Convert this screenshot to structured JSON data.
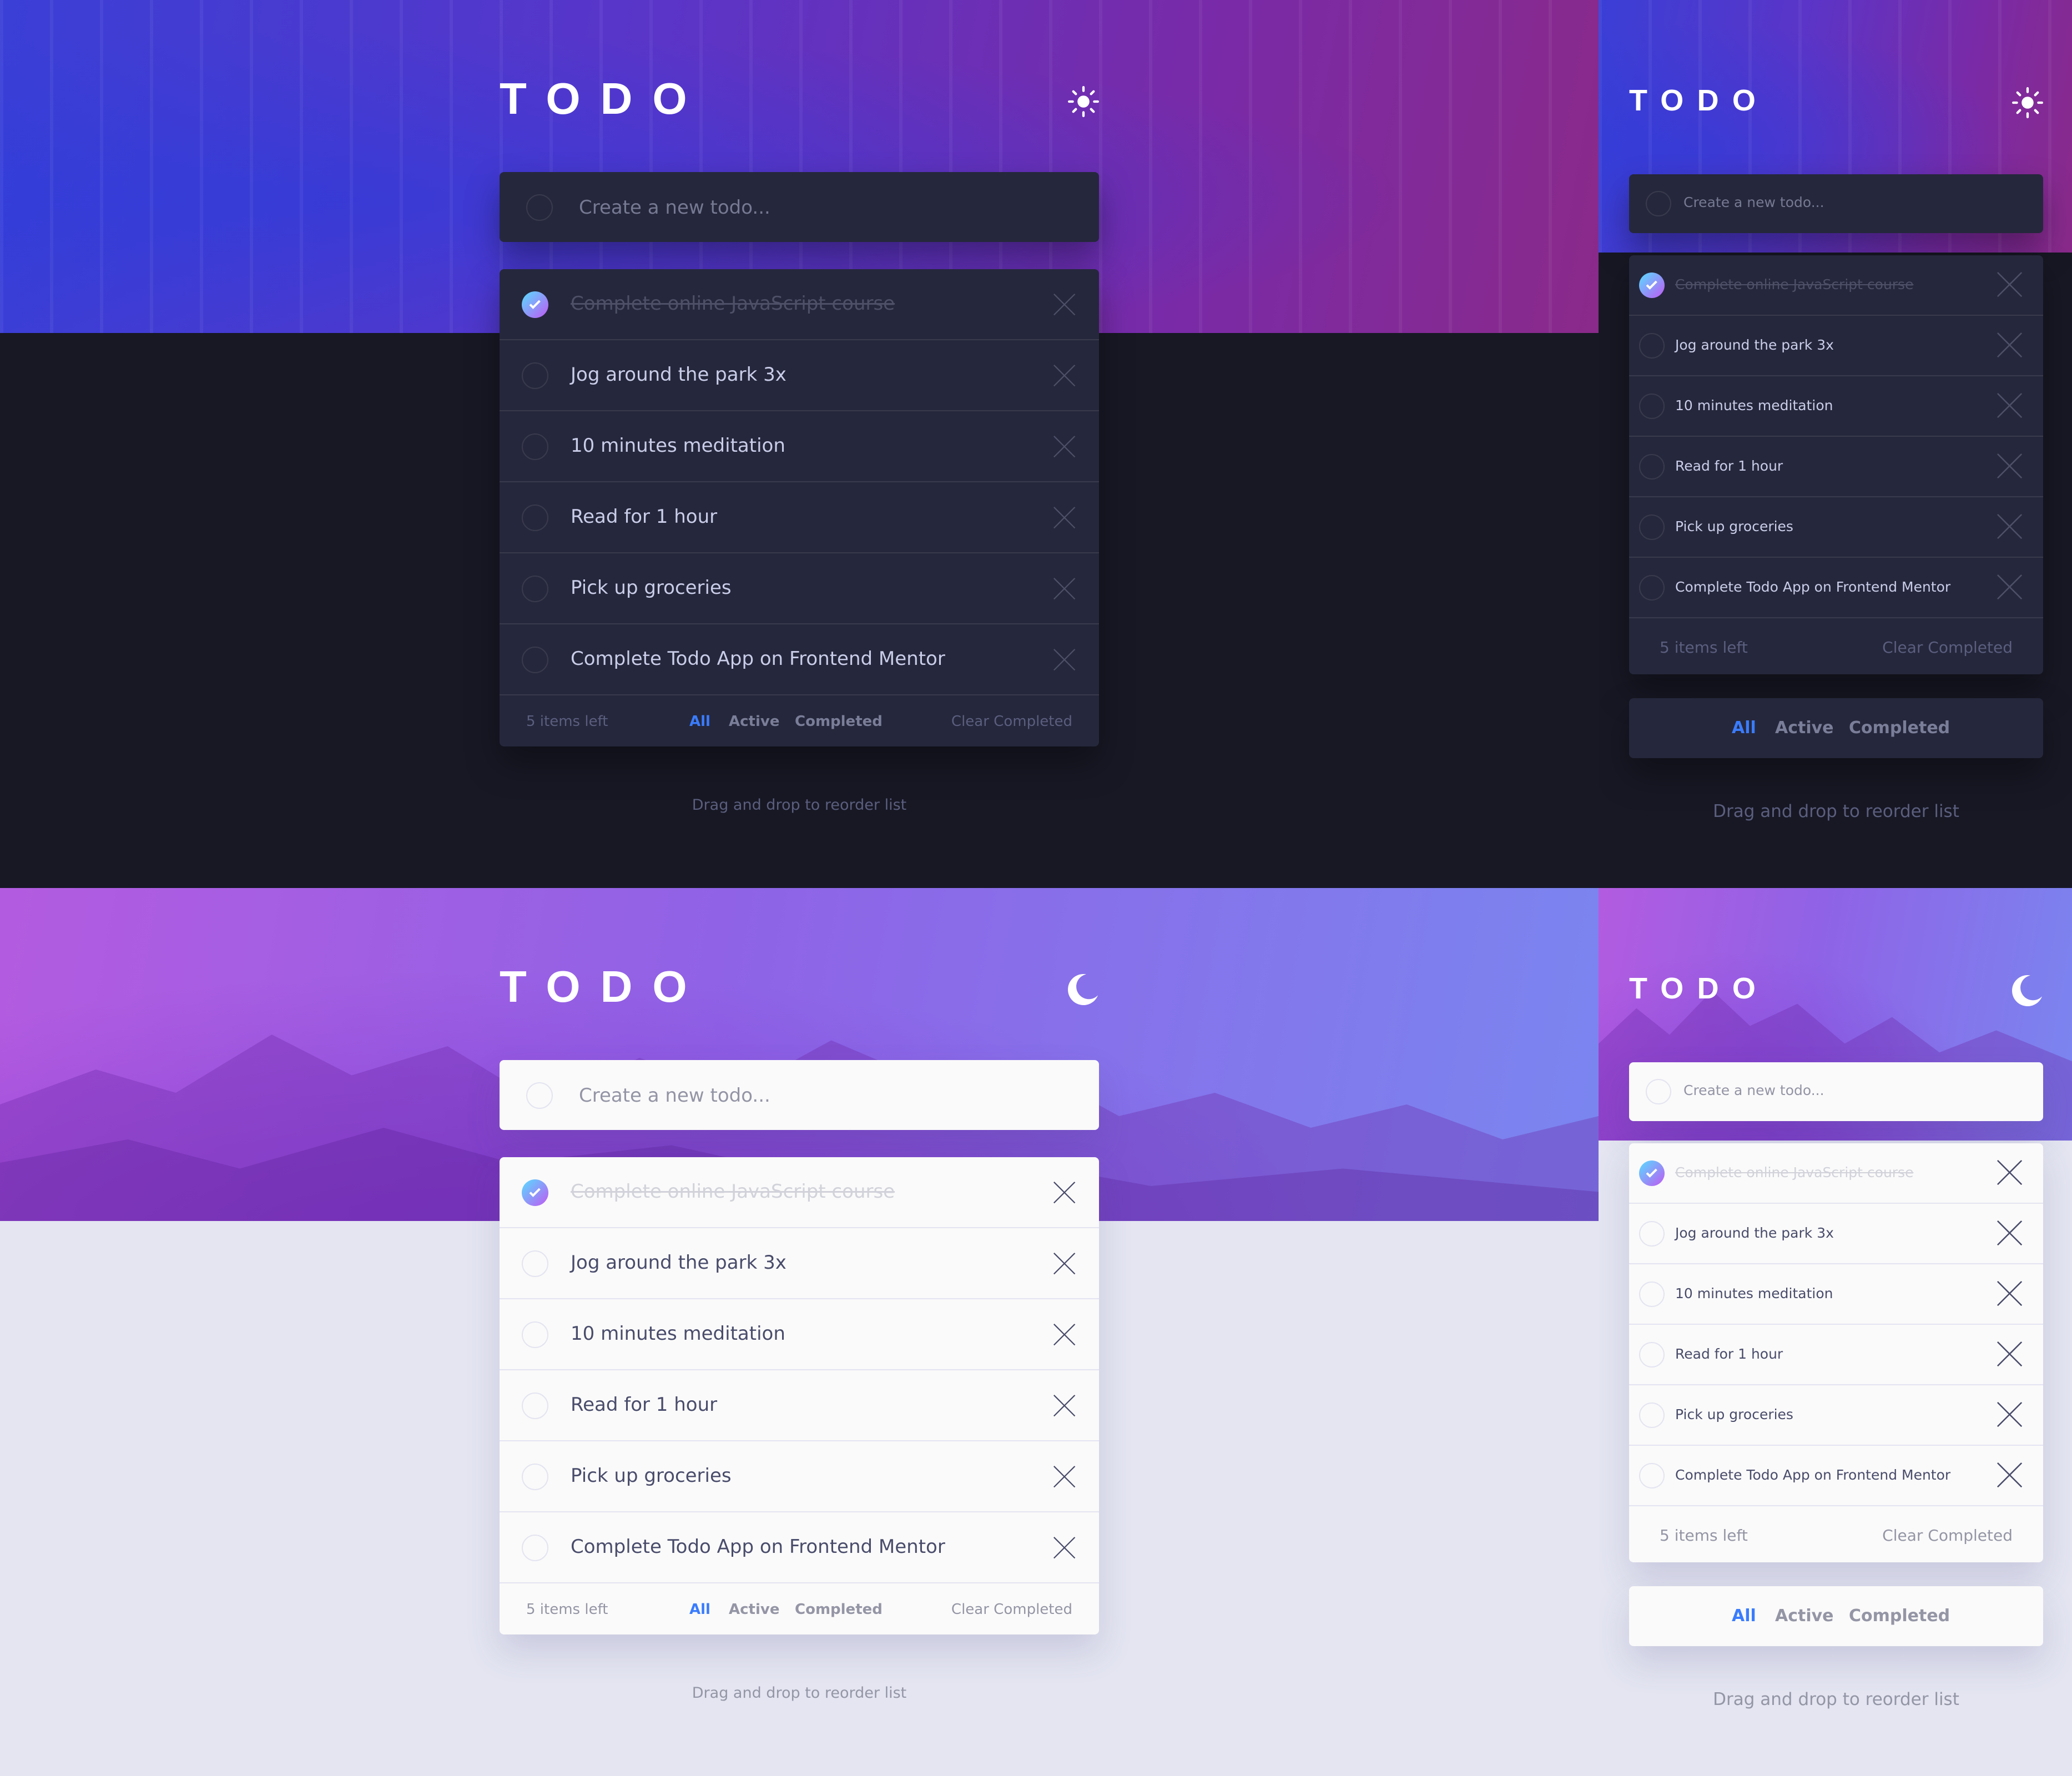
{
  "app": {
    "title": "TODO",
    "input_placeholder": "Create a new todo...",
    "todos": [
      {
        "text": "Complete online JavaScript course",
        "completed": true
      },
      {
        "text": "Jog around the park 3x",
        "completed": false
      },
      {
        "text": "10 minutes meditation",
        "completed": false
      },
      {
        "text": "Read for 1 hour",
        "completed": false
      },
      {
        "text": "Pick up groceries",
        "completed": false
      },
      {
        "text": "Complete Todo App on Frontend Mentor",
        "completed": false
      }
    ],
    "items_left": "5 items left",
    "filters": {
      "all": "All",
      "active": "Active",
      "completed": "Completed"
    },
    "active_filter": "All",
    "clear_completed": "Clear Completed",
    "hint": "Drag and drop to reorder list"
  },
  "variants": {
    "dark": {
      "theme_icon": "sun-icon",
      "background": "#171824",
      "card": "#25273c"
    },
    "light": {
      "theme_icon": "moon-icon",
      "background": "#e4e5f1",
      "card": "#fafafa"
    }
  },
  "colors": {
    "accent": "#3a7cfd",
    "check_gradient_start": "#57ddff",
    "check_gradient_end": "#c058f3"
  }
}
